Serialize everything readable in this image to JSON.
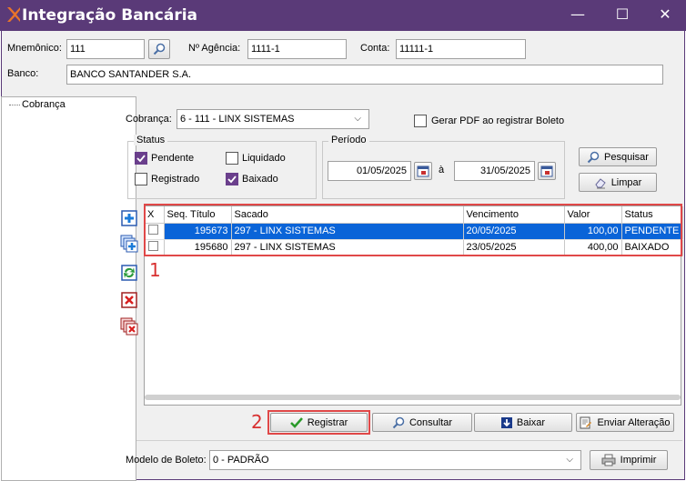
{
  "window": {
    "title": "Integração Bancária",
    "minimize": "—",
    "maximize": "☐",
    "close": "✕"
  },
  "header": {
    "mnemonico_label": "Mnemônico:",
    "mnemonico_value": "111",
    "agencia_label": "Nº Agência:",
    "agencia_value": "1111-1",
    "conta_label": "Conta:",
    "conta_value": "11111-1",
    "banco_label": "Banco:",
    "banco_value": "BANCO SANTANDER S.A."
  },
  "tree": {
    "items": [
      "Cobrança"
    ]
  },
  "filters": {
    "cobranca_label": "Cobrança:",
    "cobranca_value": "6 - 111 - LINX SISTEMAS",
    "gerar_pdf_label": "Gerar PDF ao registrar Boleto",
    "status_title": "Status",
    "pendente": "Pendente",
    "liquidado": "Liquidado",
    "registrado": "Registrado",
    "baixado": "Baixado",
    "periodo_title": "Período",
    "date_from": "01/05/2025",
    "date_sep": "à",
    "date_to": "31/05/2025",
    "pesquisar": "Pesquisar",
    "limpar": "Limpar"
  },
  "grid": {
    "columns": [
      "X",
      "Seq. Título",
      "Sacado",
      "Vencimento",
      "Valor",
      "Status"
    ],
    "rows": [
      {
        "seq": "195673",
        "sacado": "297 - LINX SISTEMAS",
        "vencimento": "20/05/2025",
        "valor": "100,00",
        "status": "PENDENTE"
      },
      {
        "seq": "195680",
        "sacado": "297 - LINX SISTEMAS",
        "vencimento": "23/05/2025",
        "valor": "400,00",
        "status": "BAIXADO"
      }
    ]
  },
  "annotations": {
    "one": "1",
    "two": "2"
  },
  "actions": {
    "registrar": "Registrar",
    "consultar": "Consultar",
    "baixar": "Baixar",
    "enviar": "Enviar Alteração"
  },
  "footer": {
    "modelo_label": "Modelo de Boleto:",
    "modelo_value": "0 - PADRÃO",
    "imprimir": "Imprimir"
  },
  "colors": {
    "titlebar": "#5a3a78",
    "selection": "#0a64d8",
    "highlight": "#e04848",
    "check": "#6a3f8c"
  }
}
